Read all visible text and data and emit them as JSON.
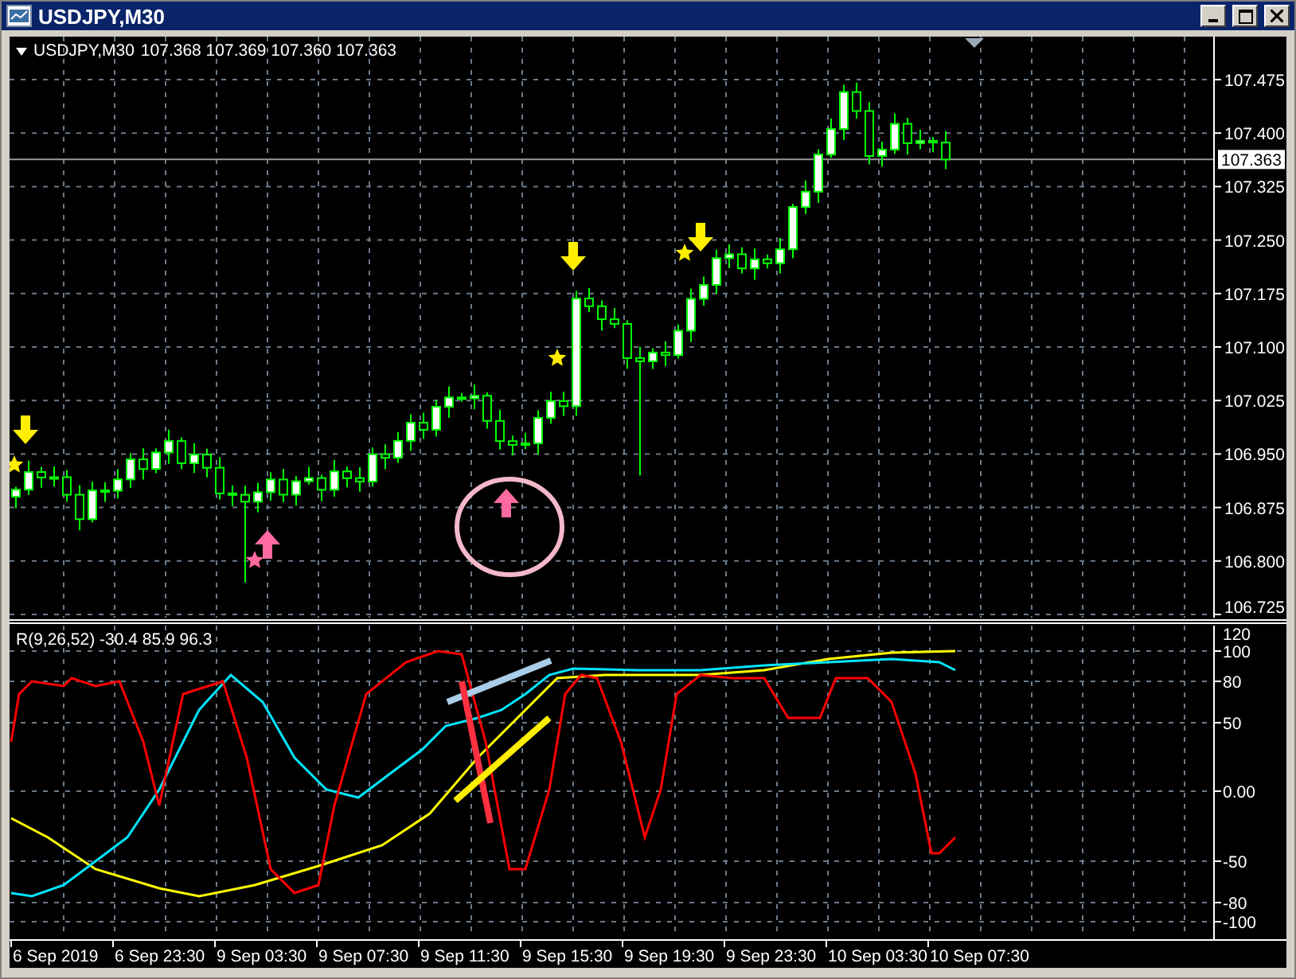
{
  "window": {
    "title": "USDJPY,M30"
  },
  "chart": {
    "symbol": "USDJPY,M30",
    "ohlc": "107.368 107.369 107.360 107.363",
    "price_axis": [
      "107.475",
      "107.400",
      "107.325",
      "107.250",
      "107.175",
      "107.100",
      "107.025",
      "106.950",
      "106.875",
      "106.800",
      "106.725"
    ],
    "current_price": "107.363"
  },
  "indicator": {
    "label": "R(9,26,52) -30.4 85.9 96.3",
    "axis": [
      "120",
      "100",
      "80",
      "50",
      "0.00",
      "-50",
      "-80",
      "-100"
    ]
  },
  "time_axis": [
    "6 Sep 2019",
    "6 Sep 23:30",
    "9 Sep 03:30",
    "9 Sep 07:30",
    "9 Sep 11:30",
    "9 Sep 15:30",
    "9 Sep 19:30",
    "9 Sep 23:30",
    "10 Sep 03:30",
    "10 Sep 07:30"
  ]
}
